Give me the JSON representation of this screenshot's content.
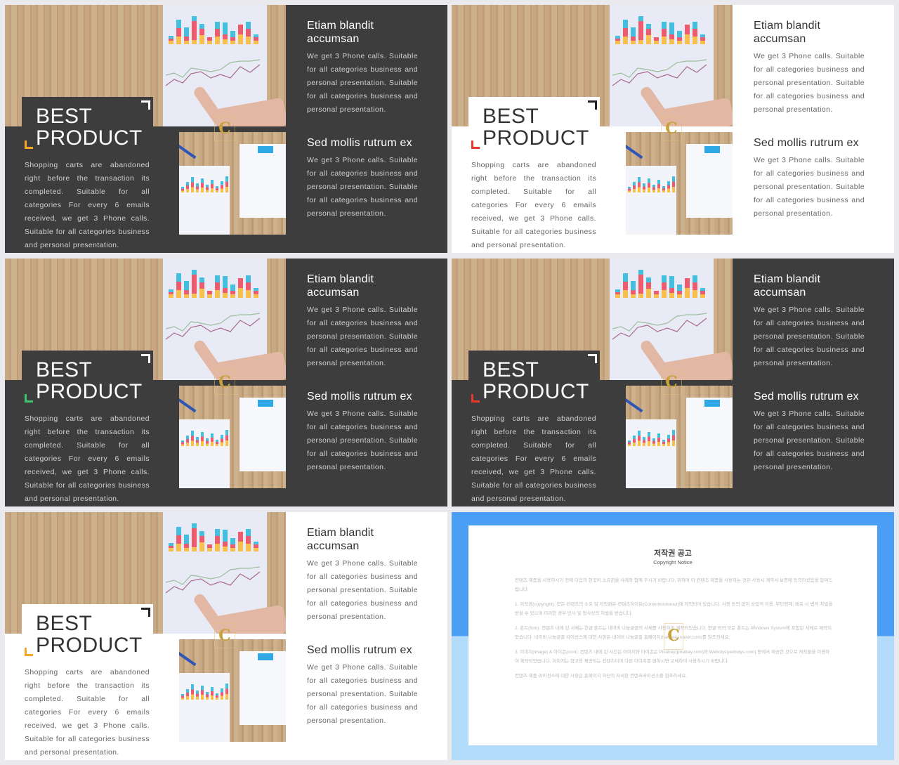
{
  "slides": [
    {
      "theme": "dark",
      "accent": "#f5a623",
      "right_panel": "dark"
    },
    {
      "theme": "light",
      "accent": "#e8392b",
      "right_panel": "light"
    },
    {
      "theme": "dark",
      "accent": "#3cc36b",
      "right_panel": "dark"
    },
    {
      "theme": "dark",
      "accent": "#e8392b",
      "right_panel": "dark"
    },
    {
      "theme": "light",
      "accent": "#f5a623",
      "right_panel": "light"
    }
  ],
  "content": {
    "title_line1": "BEST",
    "title_line2": "PRODUCT",
    "left_body": "Shopping carts are abandoned right before the transaction its completed. Suitable for all categories For every 6 emails received, we get 3 Phone calls. Suitable for all categories business and personal presentation.",
    "section1_heading": "Etiam blandit accumsan",
    "section1_body": "We get 3 Phone calls. Suitable for all categories business and personal presentation. Suitable for all categories business and personal presentation.",
    "section2_heading": "Sed mollis rutrum ex",
    "section2_body": "We get 3 Phone calls. Suitable for all categories business and personal presentation. Suitable for all categories business and personal presentation.",
    "watermark": "C"
  },
  "notice": {
    "title": "저작권 공고",
    "subtitle": "Copyright Notice",
    "intro": "컨텐츠 제품을 사용하시기 전에 다음의 한국어 소유권을 사례와 함께 주시기 바랍니다. 위하여 이 컨텐츠 제품을 사용하는 것은 사용시 계약서 보증에 동의하셨음을 알려드립니다.",
    "item1": "1. 저작권(copyright): 모든 컨텐츠의 소유 및 저작권은 컨텐츠하이브(Contentstokeout)에 저작되어 있습니다. 사전 동의 없이 상업적 이용, 무단전재, 배포 시 법적 처벌을 받을 수 있으며 이러한 경우 민사 및 형사상의 처벌을 받습니다.",
    "item2": "2. 폰트(font): 컨텐츠 내에 된 서체는 한글 폰트는 네이버 나눔글꼴의 서체를 사용하여 제작되었습니다. 한글 외의 모든 폰트는 Windows System에 포함된 서체로 제작되었습니다. 네이버 나눔글꼴 라이선스에 대한 사항은 네이버 나눔글꼴 홈페이지(hangeul.naver.com)를 참조하세요.",
    "item3": "3. 이미지(image) & 아이콘(icon): 컨텐츠 내에 된 사진은 이미지와 아이콘은 Pixabay(pixabay.com)와 Webolys(webolys.com) 등에서 제공한 것으로 저작물을 이용하여 제작되었습니다. 이미지는 참고용 제공되는 컨텐츠이며 다른 이미지를 원하시면 교체하여 사용하시기 바랍니다.",
    "footer": "컨텐츠 제품 라이선스에 대한 사항은 홈페이지 하단의 자세한 컨텐츠라이선스를 참조하세요.",
    "watermark": "C"
  }
}
